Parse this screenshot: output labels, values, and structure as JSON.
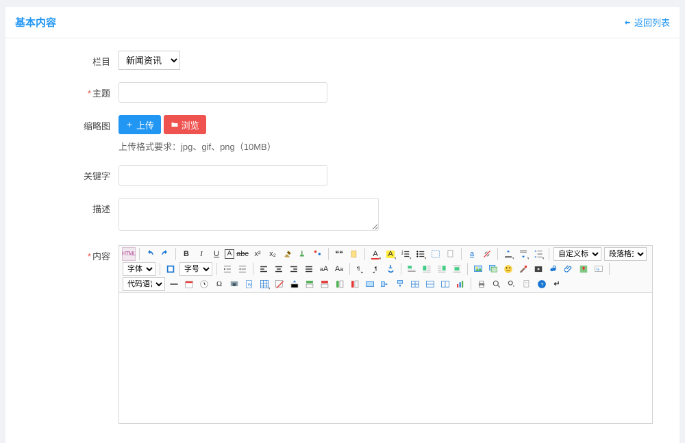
{
  "header": {
    "title": "基本内容",
    "back": "返回列表"
  },
  "form": {
    "column_label": "栏目",
    "column_value": "新闻资讯",
    "subject_label": "主题",
    "thumb_label": "缩略图",
    "upload_btn": "上传",
    "browse_btn": "浏览",
    "thumb_hint": "上传格式要求：jpg、gif、png（10MB）",
    "keyword_label": "关键字",
    "desc_label": "描述",
    "content_label": "内容"
  },
  "editor": {
    "src": "HTML",
    "custom_title": "自定义标题",
    "para_format": "段落格式",
    "font_family": "字体",
    "font_size": "字号",
    "code_lang": "代码语言",
    "bold": "B",
    "italic": "I",
    "underline": "U",
    "a_link": "a",
    "foreA": "A",
    "backA": "A",
    "t_upper": "T",
    "t_small": "t",
    "t_arrow": "T",
    "t_search": "T",
    "t_plain": "T",
    "quote": "❝❝",
    "omega": "Ω",
    "pagebreak": "↵"
  }
}
